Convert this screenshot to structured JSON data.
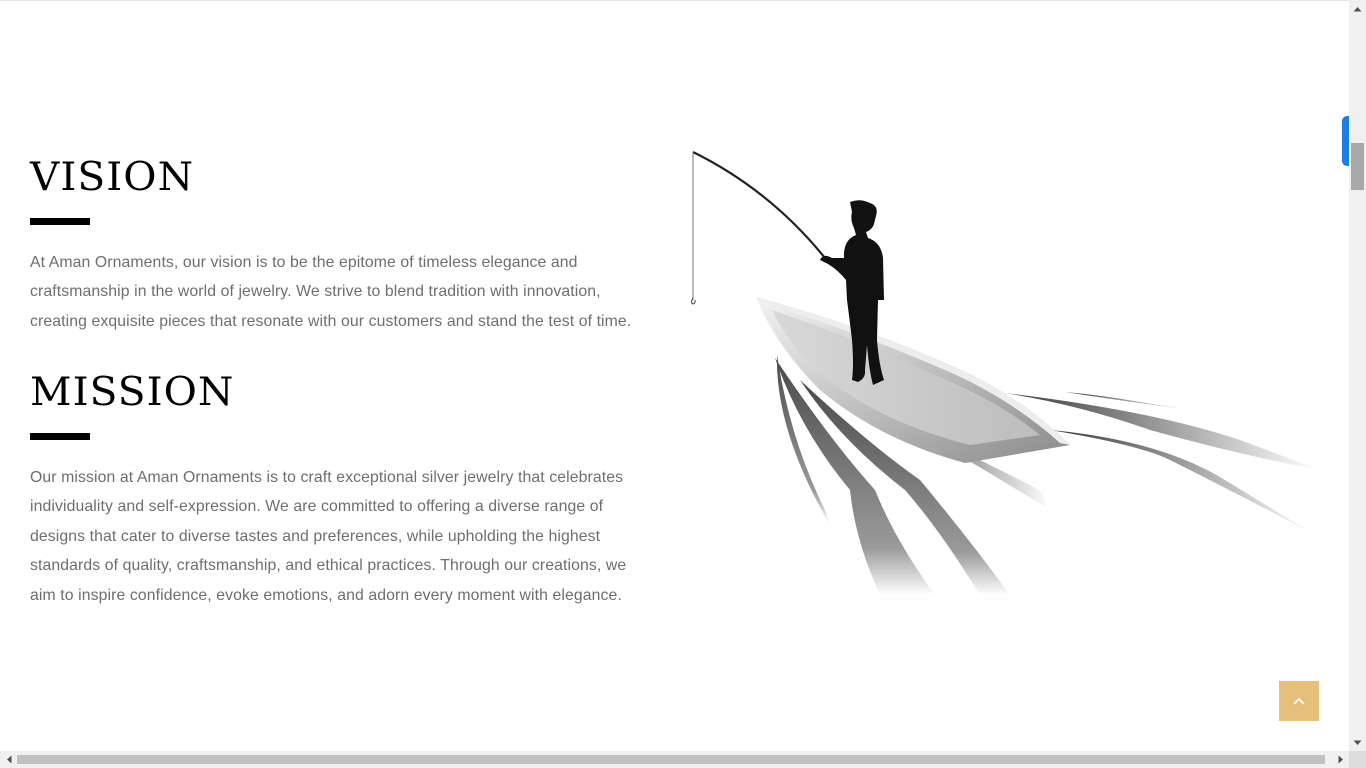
{
  "vision": {
    "heading": "VISION",
    "text": "At Aman Ornaments, our vision is to be the epitome of timeless elegance and craftsmanship in the world of jewelry. We strive to blend tradition with innovation, creating exquisite pieces that resonate with our customers and stand the test of time."
  },
  "mission": {
    "heading": "MISSION",
    "text": "Our mission at Aman Ornaments is to craft exceptional silver jewelry that celebrates individuality and self-expression. We are committed to offering a diverse range of designs that cater to diverse tastes and preferences, while upholding the highest standards of quality, craftsmanship, and ethical practices. Through our creations, we aim to inspire confidence, evoke emotions, and adorn every moment with elegance."
  },
  "illustration": {
    "subject": "fisherman-in-boat"
  },
  "back_to_top": {
    "icon": "chevron-up-icon",
    "color": "#e6c07a"
  },
  "side_tab": {
    "color": "#1a7fe0"
  }
}
